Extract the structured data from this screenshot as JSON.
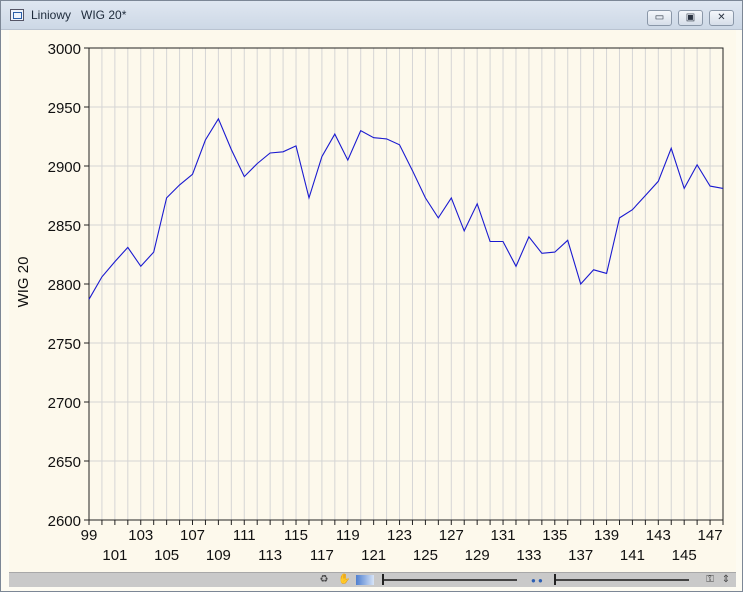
{
  "window": {
    "title": "Liniowy   WIG 20*",
    "buttons": {
      "minimize": "▭",
      "restore": "▣",
      "close": "✕"
    }
  },
  "chart_data": {
    "type": "line",
    "xlabel": "",
    "ylabel": "WIG 20",
    "x": [
      99,
      100,
      101,
      102,
      103,
      104,
      105,
      106,
      107,
      108,
      109,
      110,
      111,
      112,
      113,
      114,
      115,
      116,
      117,
      118,
      119,
      120,
      121,
      122,
      123,
      124,
      125,
      126,
      127,
      128,
      129,
      130,
      131,
      132,
      133,
      134,
      135,
      136,
      137,
      138,
      139,
      140,
      141,
      142,
      143,
      144,
      145,
      146,
      147,
      148
    ],
    "series": [
      {
        "color": "#1a1ad0",
        "values": [
          2787,
          2806,
          2819,
          2831,
          2815,
          2827,
          2873,
          2884,
          2893,
          2922,
          2940,
          2914,
          2891,
          2902,
          2911,
          2912,
          2917,
          2873,
          2908,
          2927,
          2905,
          2930,
          2924,
          2923,
          2918,
          2896,
          2873,
          2856,
          2873,
          2845,
          2868,
          2836,
          2836,
          2815,
          2840,
          2826,
          2827,
          2837,
          2800,
          2812,
          2809,
          2856,
          2863,
          2875,
          2887,
          2915,
          2881,
          2901,
          2883,
          2881
        ]
      }
    ],
    "xlim": [
      99,
      148
    ],
    "ylim": [
      2600,
      3000
    ],
    "yticks": [
      3000,
      2950,
      2900,
      2850,
      2800,
      2750,
      2700,
      2650,
      2600
    ],
    "xticks": [
      99,
      101,
      103,
      105,
      107,
      109,
      111,
      113,
      115,
      117,
      119,
      121,
      123,
      125,
      127,
      129,
      131,
      133,
      135,
      137,
      139,
      141,
      143,
      145,
      147
    ],
    "grid": true,
    "colors": {
      "background": "#fdf9ec",
      "grid": "#d5d5d5",
      "line": "#1a1ad0"
    }
  },
  "statusbar": {
    "icons": [
      "recycle-icon",
      "hand-icon"
    ],
    "dots": "● ●"
  }
}
